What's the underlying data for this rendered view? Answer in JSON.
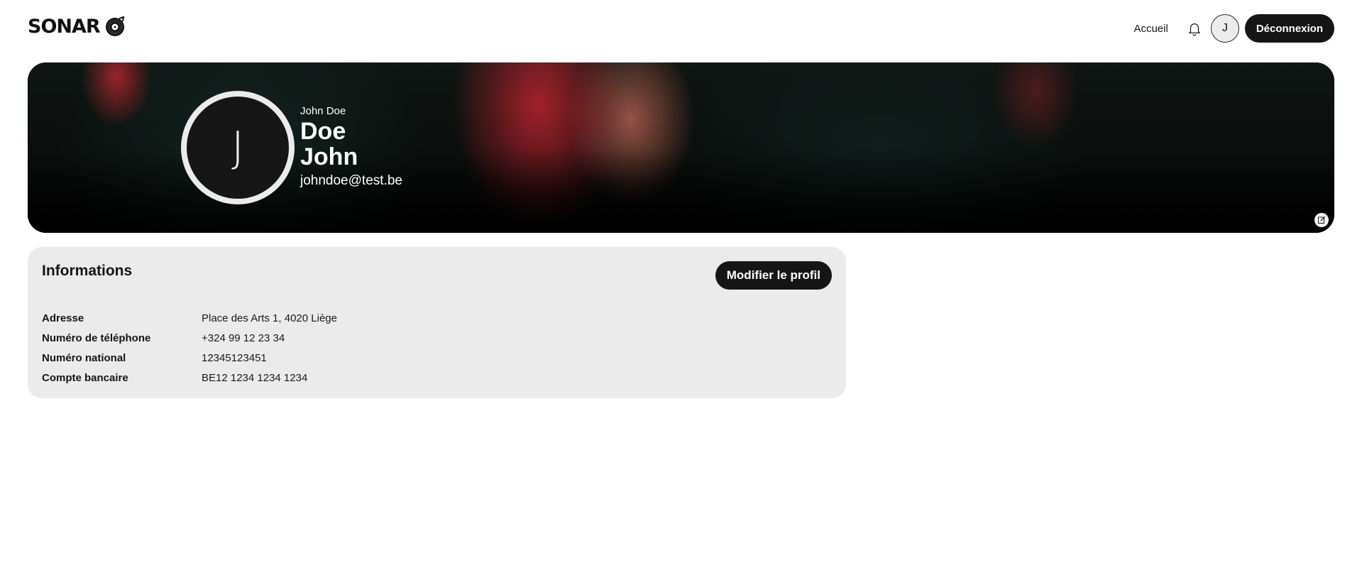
{
  "header": {
    "logo_text": "SONAR",
    "logo_icon": "vinyl-record-icon",
    "nav": {
      "home_label": "Accueil",
      "bell_icon": "bell-icon",
      "avatar_initial": "J",
      "logout_label": "Déconnexion"
    }
  },
  "banner": {
    "avatar_initial": "J",
    "full_name": "John Doe",
    "last_name": "Doe",
    "first_name": "John",
    "email": "johndoe@test.be",
    "edit_icon": "edit-icon"
  },
  "info": {
    "title": "Informations",
    "edit_button": "Modifier le profil",
    "rows": [
      {
        "label": "Adresse",
        "value": "Place des Arts 1, 4020 Liège"
      },
      {
        "label": "Numéro de téléphone",
        "value": "+324 99 12 23 34"
      },
      {
        "label": "Numéro national",
        "value": "12345123451"
      },
      {
        "label": "Compte bancaire",
        "value": "BE12 1234 1234 1234"
      }
    ]
  },
  "colors": {
    "primary_dark": "#151515",
    "card_bg": "#ebebeb",
    "accent_red": "#c0282f"
  }
}
